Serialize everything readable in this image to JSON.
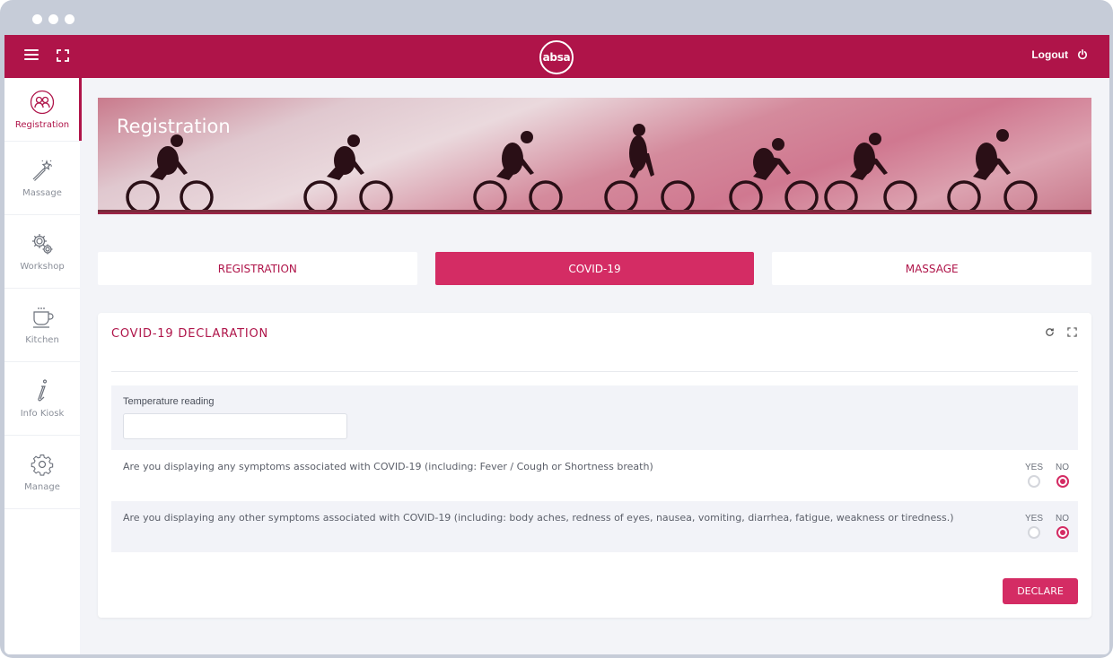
{
  "window": {
    "controls": [
      "dot",
      "dot",
      "dot"
    ]
  },
  "topbar": {
    "menu_icon": "hamburger-icon",
    "fullscreen_icon": "fullscreen-icon",
    "logo_text": "absa",
    "logout_label": "Logout",
    "logout_icon": "power-icon"
  },
  "sidebar": {
    "items": [
      {
        "label": "Registration",
        "icon": "people-icon",
        "active": true
      },
      {
        "label": "Massage",
        "icon": "magic-wand-icon",
        "active": false
      },
      {
        "label": "Workshop",
        "icon": "gears-icon",
        "active": false
      },
      {
        "label": "Kitchen",
        "icon": "coffee-cup-icon",
        "active": false
      },
      {
        "label": "Info Kiosk",
        "icon": "info-icon",
        "active": false
      },
      {
        "label": "Manage",
        "icon": "gear-icon",
        "active": false
      }
    ]
  },
  "banner": {
    "title": "Registration"
  },
  "tabs": [
    {
      "label": "REGISTRATION",
      "active": false
    },
    {
      "label": "COVID-19",
      "active": true
    },
    {
      "label": "MASSAGE",
      "active": false
    }
  ],
  "card": {
    "title": "COVID-19 DECLARATION",
    "tools": [
      "refresh-icon",
      "expand-icon"
    ],
    "temperature": {
      "label": "Temperature reading",
      "value": "",
      "placeholder": ""
    },
    "questions": [
      {
        "text": "Are you displaying any symptoms associated with COVID-19 (including: Fever / Cough or Shortness breath)",
        "options": [
          "YES",
          "NO"
        ],
        "selected": "NO"
      },
      {
        "text": "Are you displaying any other symptoms associated with COVID-19 (including: body aches, redness of eyes, nausea, vomiting, diarrhea, fatigue, weakness or tiredness.)",
        "options": [
          "YES",
          "NO"
        ],
        "selected": "NO"
      }
    ],
    "declare_label": "DECLARE"
  },
  "colors": {
    "brand": "#af1449",
    "accent": "#d42c64",
    "background": "#f3f4f8"
  }
}
